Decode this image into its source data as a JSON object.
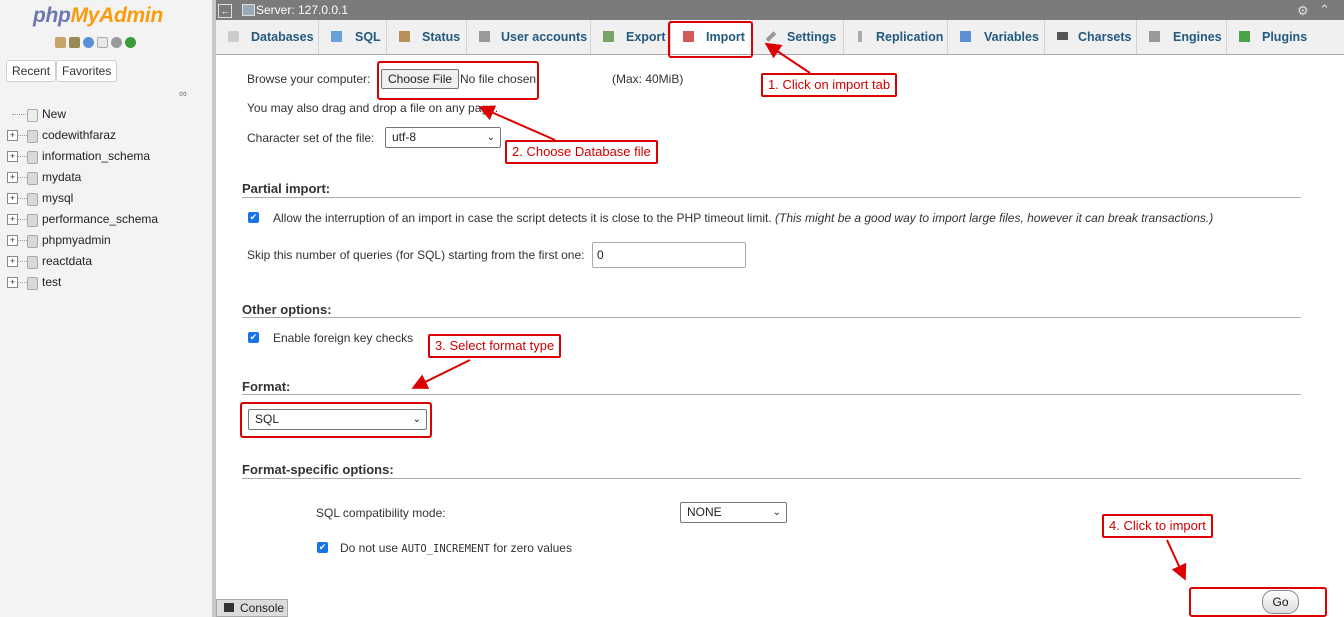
{
  "logo": {
    "php": "php",
    "my_admin": "MyAdmin"
  },
  "sidebar": {
    "tabs": [
      "Recent",
      "Favorites"
    ],
    "new_label": "New",
    "databases": [
      "codewithfaraz",
      "information_schema",
      "mydata",
      "mysql",
      "performance_schema",
      "phpmyadmin",
      "reactdata",
      "test"
    ]
  },
  "topbar": {
    "server": "Server: 127.0.0.1"
  },
  "tabs": [
    {
      "label": "Databases",
      "icon": "database-icon"
    },
    {
      "label": "SQL",
      "icon": "sql-icon"
    },
    {
      "label": "Status",
      "icon": "status-icon"
    },
    {
      "label": "User accounts",
      "icon": "users-icon"
    },
    {
      "label": "Export",
      "icon": "export-icon"
    },
    {
      "label": "Import",
      "icon": "import-icon"
    },
    {
      "label": "Settings",
      "icon": "wrench-icon"
    },
    {
      "label": "Replication",
      "icon": "replication-icon"
    },
    {
      "label": "Variables",
      "icon": "variables-icon"
    },
    {
      "label": "Charsets",
      "icon": "charsets-icon"
    },
    {
      "label": "Engines",
      "icon": "engines-icon"
    },
    {
      "label": "Plugins",
      "icon": "plugins-icon"
    }
  ],
  "file_upload": {
    "browse_label": "Browse your computer:",
    "choose_file": "Choose File",
    "no_file": "No file chosen",
    "max": "(Max: 40MiB)",
    "drag_drop": "You may also drag and drop a file on any page.",
    "charset_label": "Character set of the file:",
    "charset_value": "utf-8"
  },
  "partial_import": {
    "title": "Partial import:",
    "allow_interrupt": "Allow the interruption of an import in case the script detects it is close to the PHP timeout limit.",
    "allow_interrupt_note": "(This might be a good way to import large files, however it can break transactions.)",
    "skip_label": "Skip this number of queries (for SQL) starting from the first one:",
    "skip_value": "0"
  },
  "other_options": {
    "title": "Other options:",
    "foreign_key": "Enable foreign key checks"
  },
  "format": {
    "title": "Format:",
    "value": "SQL"
  },
  "format_specific": {
    "title": "Format-specific options:",
    "compat_label": "SQL compatibility mode:",
    "compat_value": "NONE",
    "auto_increment_prefix": "Do not use",
    "auto_increment_code": "AUTO_INCREMENT",
    "auto_increment_suffix": "for zero values"
  },
  "annotations": {
    "step1": "1. Click on import tab",
    "step2": "2. Choose Database file",
    "step3": "3. Select format type",
    "step4": "4. Click to import"
  },
  "go": "Go",
  "console": "Console",
  "colors": {
    "annotation": "#dd0000",
    "tab_text": "#235a81",
    "checkbox": "#1a73e8"
  }
}
